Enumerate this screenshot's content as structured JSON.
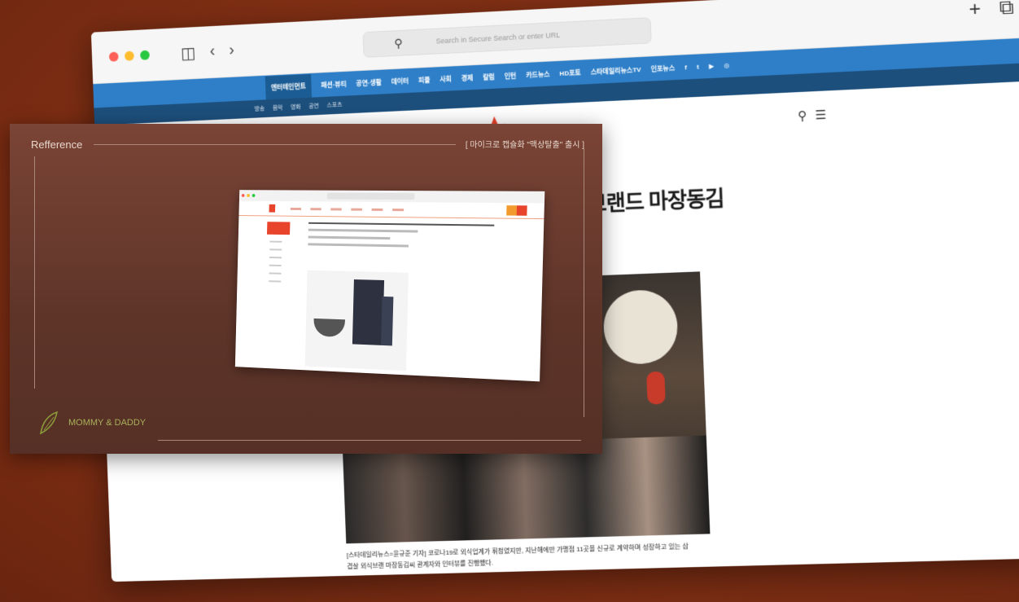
{
  "browser": {
    "url_placeholder": "Search in Secure Search or enter URL",
    "nav_primary": [
      "엔터테인먼트",
      "패션·뷰티",
      "공연·생활",
      "데이터",
      "피플",
      "사회",
      "경제",
      "칼럼",
      "인턴",
      "카드뉴스",
      "HD포토",
      "스타데일리뉴스TV",
      "인포뉴스"
    ],
    "nav_secondary": [
      "방송",
      "음악",
      "영화",
      "공연",
      "스포츠"
    ],
    "article_title": "외식브랜드 마장동김",
    "caption": "[스타데일리뉴스=윤규준 기자] 코로나19로 외식업계가 휘청였지만, 지난해에만 가맹점 11곳을 신규로 계약하며 성장하고 있는 삼겹살 외식브랜 마장동김씨 관계자와 인터뷰를 진행했다."
  },
  "reference": {
    "label": "Refference",
    "caption": "[ 마이크로 캡슐화 \"맥상탈출\" 출시 ]",
    "brand": "MOMMY & DADDY"
  },
  "colors": {
    "nav_blue": "#2e7fc8",
    "background": "#8e3517",
    "panel": "#6a3a2d"
  }
}
